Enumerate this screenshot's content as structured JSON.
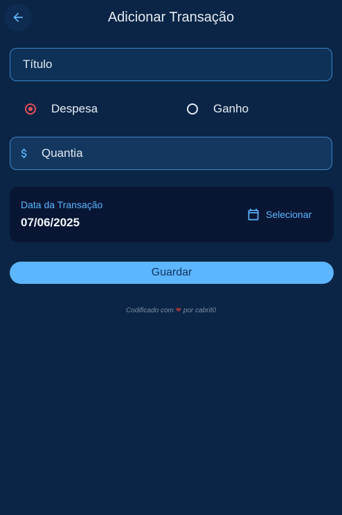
{
  "app_bar": {
    "title": "Adicionar Transação",
    "back_icon": "arrow-left-icon"
  },
  "form": {
    "title_field": {
      "placeholder": "Título",
      "value": ""
    },
    "type": {
      "options": [
        {
          "label": "Despesa",
          "selected": true
        },
        {
          "label": "Ganho",
          "selected": false
        }
      ]
    },
    "amount_field": {
      "placeholder": "Quantia",
      "value": "",
      "icon": "dollar-icon"
    },
    "date": {
      "label": "Data da Transação",
      "value": "07/06/2025",
      "select_label": "Selecionar",
      "select_icon": "calendar-icon"
    },
    "save_label": "Guardar"
  },
  "footer": {
    "prefix": "Codificado com",
    "heart": "❤",
    "suffix": "por cabrit0"
  },
  "colors": {
    "background": "#0a2545",
    "accent": "#5cb6ff",
    "expense_red": "#e8505b",
    "card": "#081634"
  }
}
